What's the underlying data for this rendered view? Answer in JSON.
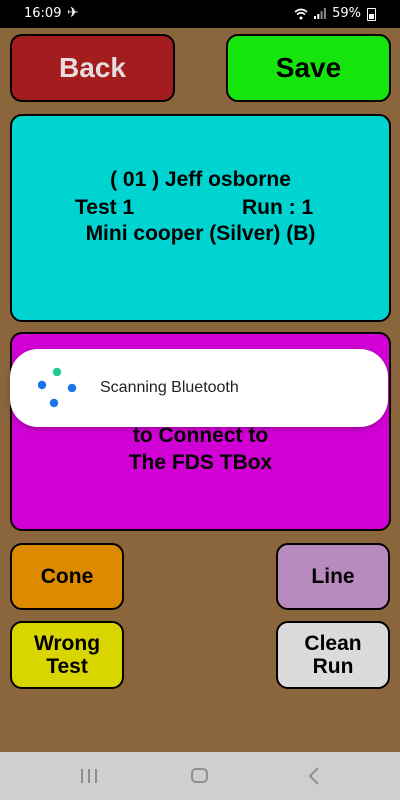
{
  "status_bar": {
    "time": "16:09",
    "airplane_icon": "airplane-icon",
    "battery": "59%"
  },
  "header": {
    "back_label": "Back",
    "save_label": "Save"
  },
  "driver_info": {
    "line1": "( 01 ) Jeff osborne",
    "test_label": "Test  1",
    "run_label": "Run :  1",
    "car_label": "Mini cooper (Silver) (B)"
  },
  "tbox_panel": {
    "line1": "to Connect to",
    "line2": "The FDS TBox"
  },
  "toast": {
    "message": "Scanning Bluetooth"
  },
  "actions": {
    "cone_label": "Cone",
    "line_label": "Line",
    "wrong_test_label": "Wrong Test",
    "clean_run_label": "Clean Run"
  },
  "colors": {
    "background": "#8b653b",
    "back_button": "#a31d1f",
    "save_button": "#15e50c",
    "info_panel": "#00d4d0",
    "tbox_panel": "#d100d4",
    "cone_button": "#dd8a00",
    "line_button": "#b98abd",
    "wrong_test_button": "#d8d500",
    "clean_run_button": "#dbdbdb"
  }
}
